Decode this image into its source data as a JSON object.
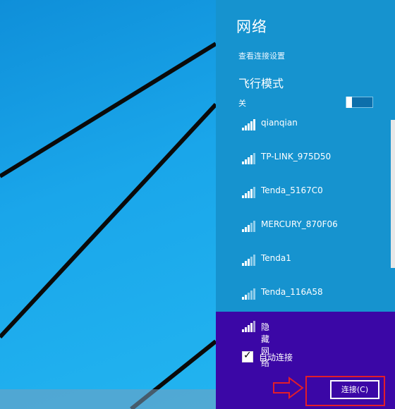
{
  "panel": {
    "title": "网络",
    "view_settings_link": "查看连接设置",
    "airplane_mode": {
      "heading": "飞行模式",
      "state": "关"
    }
  },
  "networks": [
    {
      "name": "qianqian"
    },
    {
      "name": "TP-LINK_975D50"
    },
    {
      "name": "Tenda_5167C0"
    },
    {
      "name": "MERCURY_870F06"
    },
    {
      "name": "Tenda1"
    },
    {
      "name": "Tenda_116A58"
    }
  ],
  "selected_network": {
    "name": "隐藏网络",
    "auto_connect_label": "自动连接",
    "auto_connect_checked": true,
    "connect_button": "连接(C)"
  },
  "colors": {
    "panel_bg": "#1693cf",
    "selected_bg": "#3b07a6",
    "annotation_red": "#e21d2a"
  }
}
